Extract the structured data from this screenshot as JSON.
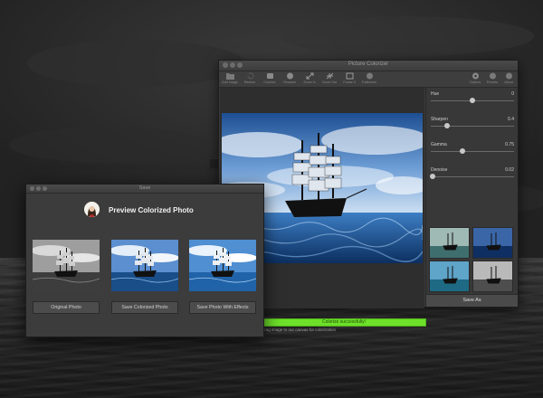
{
  "main_window": {
    "title": "Picture Colorizer",
    "toolbar": [
      {
        "name": "add-image",
        "label": "Add Image"
      },
      {
        "name": "restore",
        "label": "Restore"
      },
      {
        "name": "colorize",
        "label": "Colorize"
      },
      {
        "name": "rename",
        "label": "Rename"
      },
      {
        "name": "zoom-in",
        "label": "Zoom In"
      },
      {
        "name": "zoom-out",
        "label": "Zoom Out"
      },
      {
        "name": "crop",
        "label": "Frame It"
      },
      {
        "name": "fullscreen",
        "label": "Fullscreen"
      }
    ],
    "toolbar_right": [
      {
        "name": "options",
        "label": "Options"
      },
      {
        "name": "presets",
        "label": "Presets"
      },
      {
        "name": "about",
        "label": "About"
      }
    ],
    "status": "Colorize successfully!",
    "caption": "Drag image to our canvas for colorization",
    "sliders": [
      {
        "label": "Hue",
        "value": "0",
        "fraction": 0.5
      },
      {
        "label": "Sharpen",
        "value": "0.4",
        "fraction": 0.2
      },
      {
        "label": "Gamma",
        "value": "0.75",
        "fraction": 0.375
      },
      {
        "label": "Denoise",
        "value": "0.02",
        "fraction": 0.02
      }
    ],
    "save_as_label": "Save As"
  },
  "save_window": {
    "title": "Save",
    "heading": "Preview Colorized Photo",
    "buttons": [
      {
        "label": "Original Photo"
      },
      {
        "label": "Save Colorized Photo"
      },
      {
        "label": "Save Photo With Effects"
      }
    ]
  },
  "colors": {
    "accent_green": "#6ee02a",
    "window_bg": "#3a3a3a",
    "sky_blue": "#2f6fb8"
  }
}
